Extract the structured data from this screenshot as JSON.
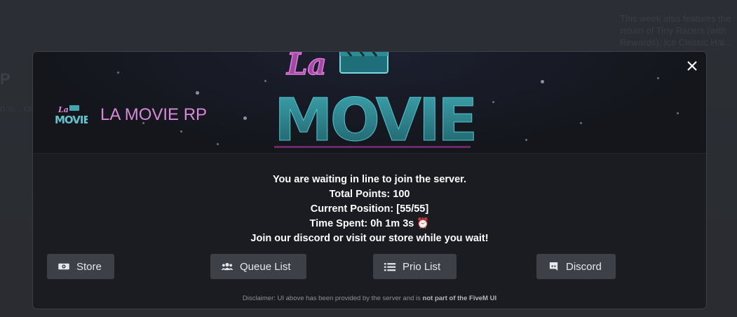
{
  "background": {
    "right_text": "This week also features the return of Tiny Racers (with Rewards), Ice Classic Hal... Race...",
    "left_text_large": "P",
    "left_text_small": "n w... rate..."
  },
  "modal": {
    "banner_logo_text": "La MOVIE",
    "server_logo_text": "La MOVIE",
    "server_name": "LA MOVIE RP",
    "close_icon": "close-icon",
    "queue": {
      "line1": "You are waiting in line to join the server.",
      "line2": "Total Points: 100",
      "line3": "Current Position: [55/55]",
      "line4": "Time Spent: 0h 1m 3s",
      "line4_emoji": "⏰",
      "line5": "Join our discord or visit our store while you wait!"
    },
    "buttons": {
      "store": {
        "label": "Store",
        "icon": "money-icon"
      },
      "queue_list": {
        "label": "Queue List",
        "icon": "users-icon"
      },
      "prio_list": {
        "label": "Prio List",
        "icon": "list-icon"
      },
      "discord": {
        "label": "Discord",
        "icon": "discord-icon"
      }
    },
    "disclaimer": {
      "prefix": "Disclaimer: UI above has been provided by the server and is ",
      "bold": "not part of the FiveM UI"
    }
  },
  "colors": {
    "accent_pink": "#d88ad8",
    "teal": "#3fa7b0",
    "button_bg": "#3d4047",
    "modal_bg": "#1a1c22"
  }
}
